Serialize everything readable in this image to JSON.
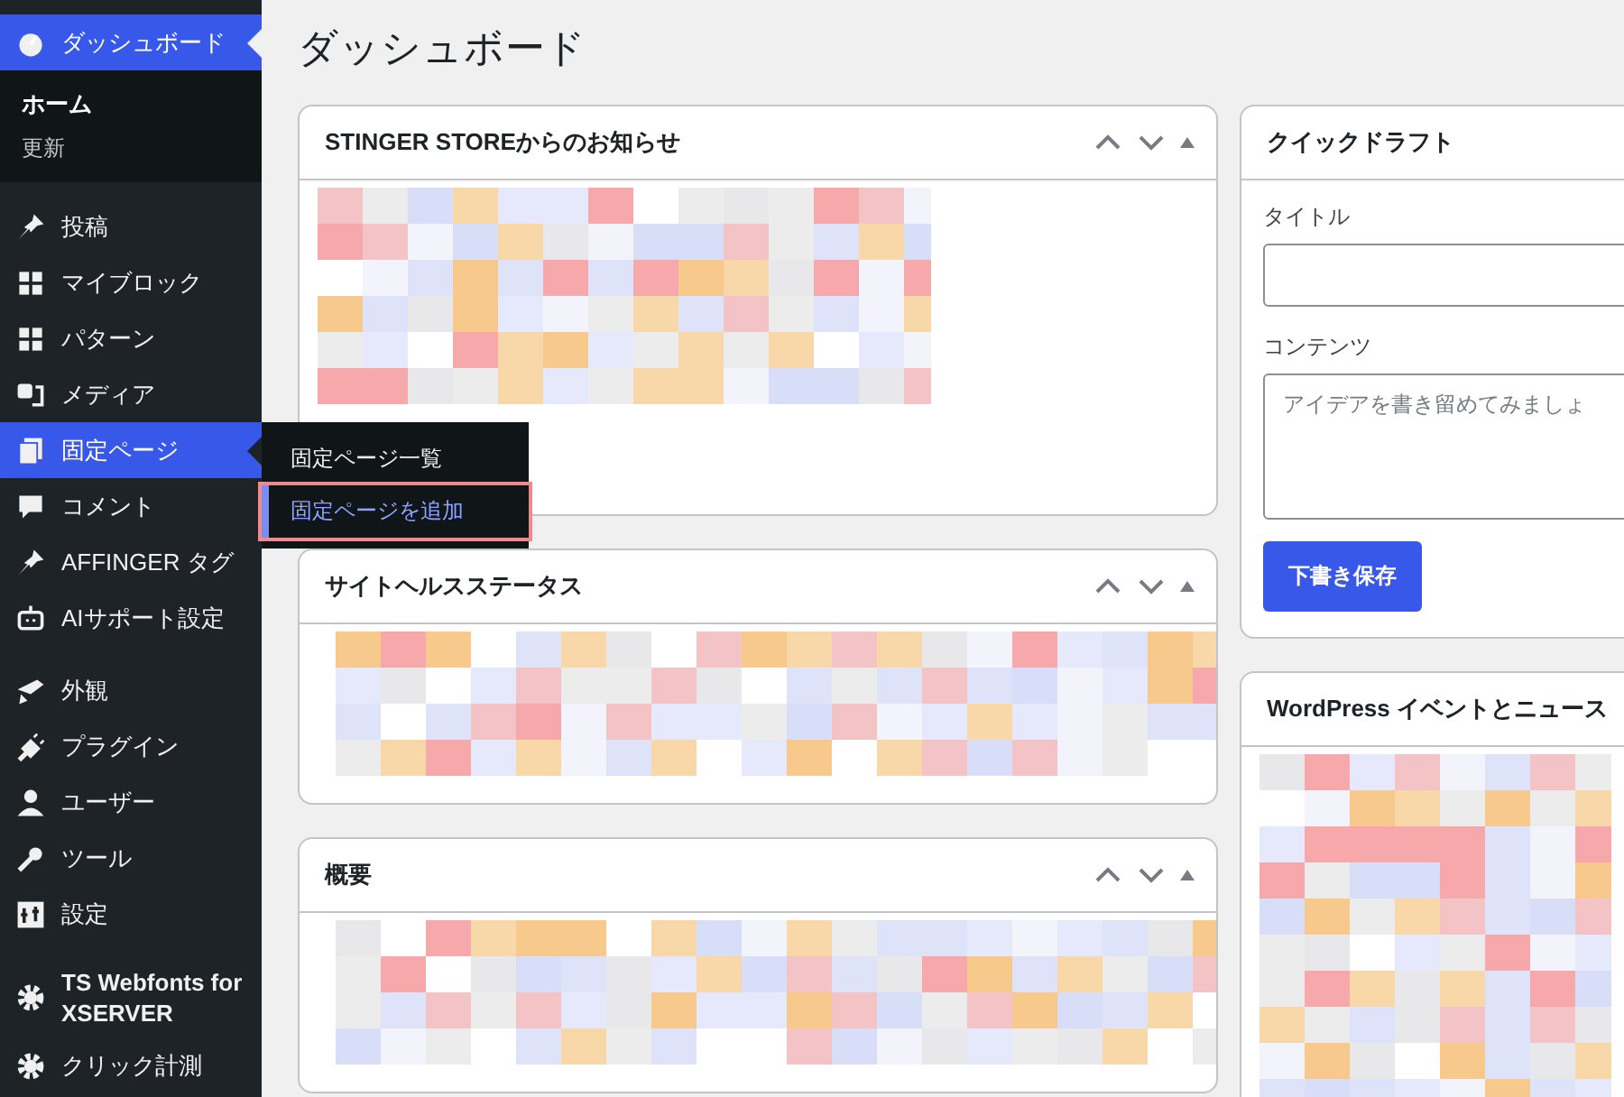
{
  "sidebar": {
    "groups": [
      [
        {
          "label": "ダッシュボード",
          "selected": true,
          "children": [
            {
              "label": "ホーム",
              "selected": true
            },
            {
              "label": "更新",
              "selected": false
            }
          ]
        }
      ],
      [
        {
          "label": "投稿",
          "selected": false
        },
        {
          "label": "マイブロック",
          "selected": false
        },
        {
          "label": "パターン",
          "selected": false
        },
        {
          "label": "メディア",
          "selected": false
        },
        {
          "label": "固定ページ",
          "selected": false,
          "hovered": true,
          "flyout": [
            {
              "label": "固定ページ一覧",
              "highlighted": false
            },
            {
              "label": "固定ページを追加",
              "highlighted": true
            }
          ]
        },
        {
          "label": "コメント",
          "selected": false
        },
        {
          "label": "AFFINGER タグ",
          "selected": false
        },
        {
          "label": "AIサポート設定",
          "selected": false
        }
      ],
      [
        {
          "label": "外観",
          "selected": false
        },
        {
          "label": "プラグイン",
          "selected": false
        },
        {
          "label": "ユーザー",
          "selected": false
        },
        {
          "label": "ツール",
          "selected": false
        },
        {
          "label": "設定",
          "selected": false
        }
      ],
      [
        {
          "label": "TS Webfonts for XSERVER",
          "selected": false
        },
        {
          "label": "クリック計測",
          "selected": false
        }
      ]
    ]
  },
  "page_title": "ダッシュボード",
  "left_panels": [
    {
      "title": "STINGER STOREからのお知らせ"
    },
    {
      "title": "サイトヘルスステータス"
    },
    {
      "title": "概要"
    }
  ],
  "quick_draft": {
    "title": "クイックドラフト",
    "title_label": "タイトル",
    "content_label": "コンテンツ",
    "placeholder": "アイデアを書き留めてみましょ",
    "save_button": "下書き保存"
  },
  "events_panel": {
    "title": "WordPress イベントとニュース"
  }
}
